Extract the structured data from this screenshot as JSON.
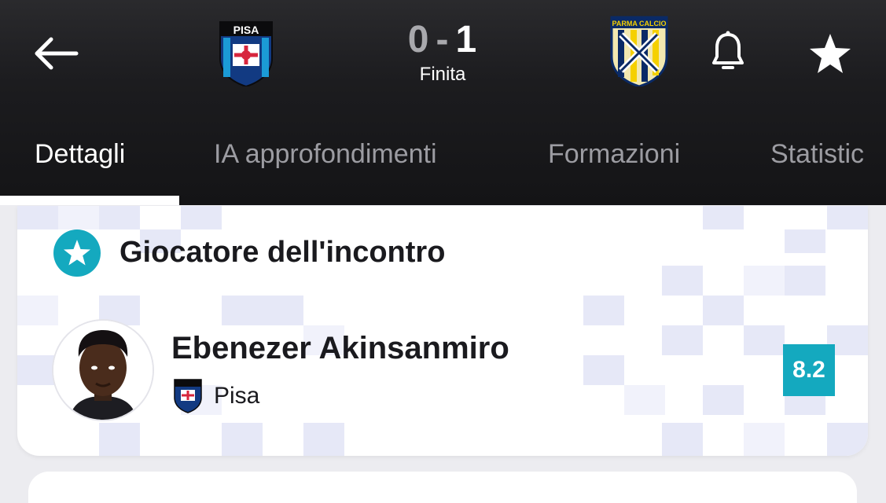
{
  "header": {
    "home_team": {
      "crest_text": "PISA",
      "goals": "0"
    },
    "away_team": {
      "crest_text": "PARMA CALCIO",
      "goals": "1"
    },
    "score_separator": "-",
    "status": "Finita"
  },
  "tabs": [
    {
      "label": "Dettagli",
      "active": true
    },
    {
      "label": "IA approfondimenti",
      "active": false
    },
    {
      "label": "Formazioni",
      "active": false
    },
    {
      "label": "Statistic",
      "active": false
    }
  ],
  "player_of_match": {
    "title": "Giocatore dell'incontro",
    "player_name": "Ebenezer Akinsanmiro",
    "team": "Pisa",
    "rating": "8.2"
  },
  "colors": {
    "accent": "#14a9bf",
    "header_bg": "#1c1c1f",
    "pattern": "#e6e8f7"
  },
  "icons": {
    "back": "arrow-left-icon",
    "bell": "bell-icon",
    "favorite": "star-icon",
    "title": "star-badge-icon"
  }
}
